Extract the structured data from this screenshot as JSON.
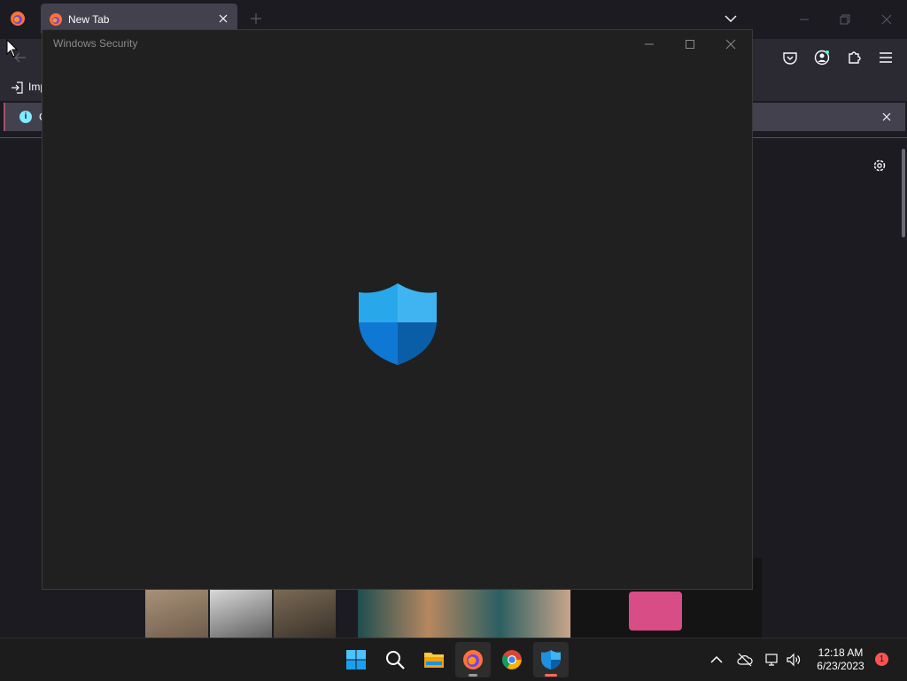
{
  "browser": {
    "tab_title": "New Tab",
    "bookmark_label": "Imp",
    "infobar_text": "C"
  },
  "dialog": {
    "title": "Windows Security"
  },
  "taskbar": {
    "apps": [
      "start-icon",
      "search-icon",
      "file-explorer-icon",
      "firefox-icon",
      "chrome-icon",
      "windows-security-icon"
    ],
    "time": "12:18 AM",
    "date": "6/23/2023",
    "notification_count": "1"
  },
  "colors": {
    "browser_bg": "#1c1b22",
    "dialog_bg": "#202020",
    "shield_light": "#28a8ea",
    "shield_dark": "#0a5ea8",
    "taskbar_bg": "#1c1c1c"
  }
}
